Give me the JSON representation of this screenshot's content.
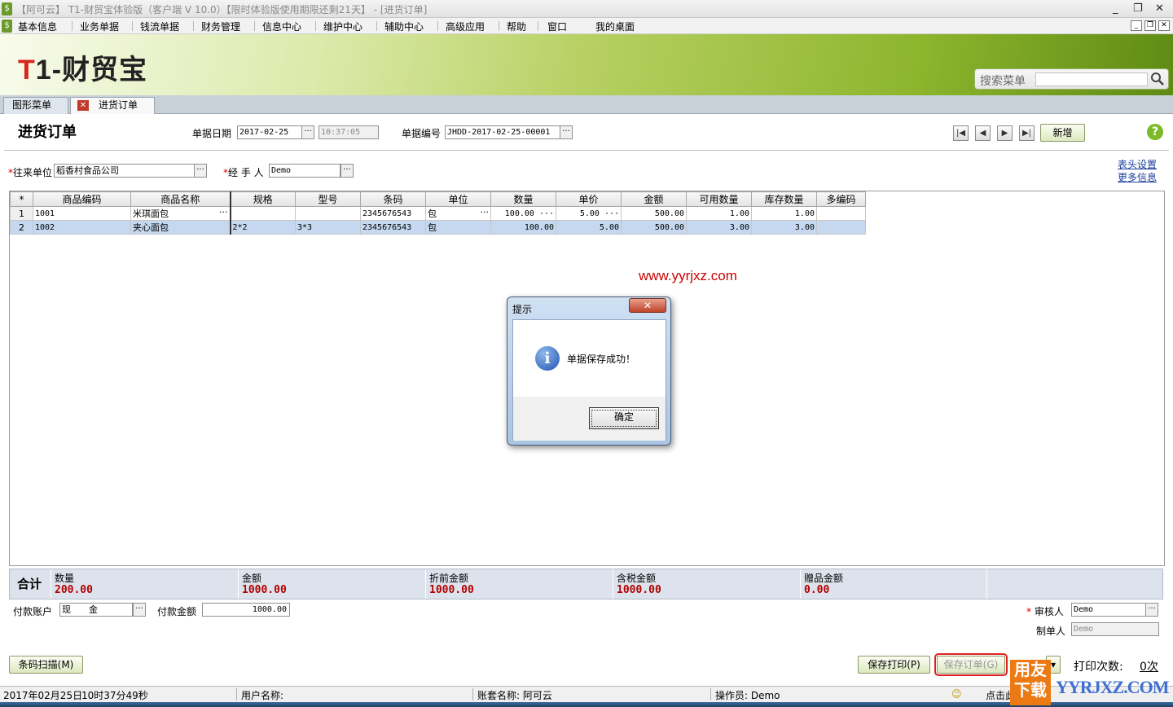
{
  "window": {
    "title": "【阿可云】 T1-财贸宝体验版（客户端 V 10.0）【限时体验版使用期限还剩21天】 - [进货订单]",
    "min": "_",
    "restore": "❐",
    "close": "✕"
  },
  "menu": {
    "items": [
      "基本信息",
      "业务单据",
      "钱流单据",
      "财务管理",
      "信息中心",
      "维护中心",
      "辅助中心",
      "高级应用",
      "帮助",
      "窗口",
      "我的桌面"
    ]
  },
  "brand": {
    "logo_t": "T",
    "logo_one": "1",
    "logo_rest": "-财贸宝"
  },
  "search": {
    "label": "搜索菜单",
    "placeholder": "",
    "value": ""
  },
  "tabs": [
    {
      "label": "图形菜单"
    },
    {
      "label": "进货订单"
    }
  ],
  "doc": {
    "title": "进货订单",
    "date_label": "单据日期",
    "date_value": "2017-02-25",
    "time_value": "10:37:05",
    "no_label": "单据编号",
    "no_value": "JHDD-2017-02-25-00001",
    "new_button": "新增",
    "help": "?",
    "partner_label": "往来单位",
    "partner_value": "稻香村食品公司",
    "handler_label": "经 手 人",
    "handler_value": "Demo",
    "link_header_settings": "表头设置",
    "link_more_info": "更多信息",
    "dots": "···"
  },
  "grid": {
    "columns": [
      "*",
      "商品编码",
      "商品名称",
      "规格",
      "型号",
      "条码",
      "单位",
      "数量",
      "单价",
      "金额",
      "可用数量",
      "库存数量",
      "多编码"
    ],
    "rows": [
      {
        "n": "1",
        "code": "1001",
        "name": "米琪面包",
        "spec": "",
        "model": "",
        "barcode": "2345676543",
        "unit": "包",
        "qty": "100.00",
        "price": "5.00",
        "amount": "500.00",
        "avail": "1.00",
        "stock": "1.00",
        "multi": ""
      },
      {
        "n": "2",
        "code": "1002",
        "name": "夹心面包",
        "spec": "2*2",
        "model": "3*3",
        "barcode": "2345676543",
        "unit": "包",
        "qty": "100.00",
        "price": "5.00",
        "amount": "500.00",
        "avail": "3.00",
        "stock": "3.00",
        "multi": ""
      }
    ]
  },
  "watermark": "www.yyrjxz.com",
  "totals": {
    "label": "合计",
    "items": [
      {
        "label": "数量",
        "value": "200.00"
      },
      {
        "label": "金额",
        "value": "1000.00"
      },
      {
        "label": "折前金额",
        "value": "1000.00"
      },
      {
        "label": "含税金额",
        "value": "1000.00"
      },
      {
        "label": "赠品金额",
        "value": "0.00"
      }
    ]
  },
  "footer": {
    "pay_account_label": "付款账户",
    "pay_account_value": "现　　金",
    "pay_amount_label": "付款金额",
    "pay_amount_value": "1000.00",
    "auditor_label": "审核人",
    "auditor_value": "Demo",
    "maker_label": "制单人",
    "maker_value": "Demo",
    "barcode_scan": "条码扫描(M)",
    "save_print": "保存打印(P)",
    "save_order": "保存订单(G)",
    "print_count_label": "打印次数:",
    "print_count_value": "0次"
  },
  "dialog": {
    "title": "提示",
    "close": "✕",
    "icon": "i",
    "message": "单据保存成功！",
    "ok": "确定"
  },
  "status": {
    "date": "2017年02月25日",
    "time": "10时37分49秒",
    "user_label": "用户名称:",
    "account_label": "账套名称: 阿可云",
    "operator_label": "操作员: Demo",
    "hint": "点击此"
  },
  "corner": {
    "badge_top": "用友",
    "badge_bottom": "下载",
    "text": "YYRJXZ.COM"
  }
}
